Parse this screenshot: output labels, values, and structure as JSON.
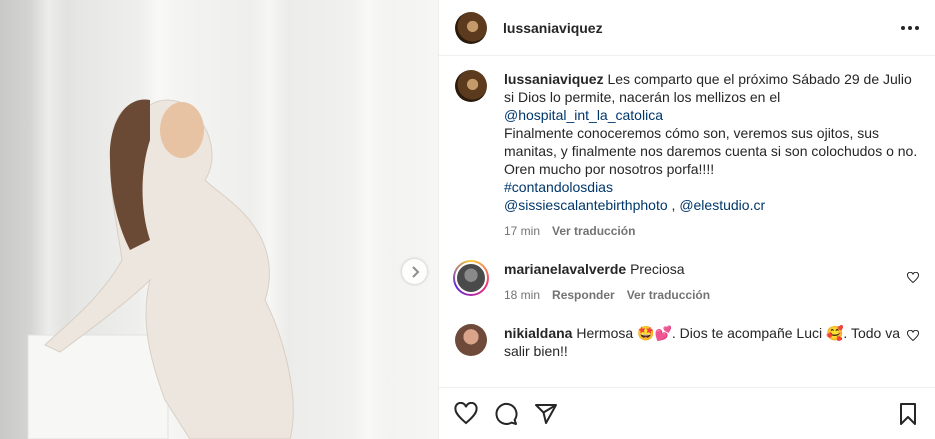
{
  "post": {
    "username": "lussaniaviquez",
    "caption_lines": [
      "Les comparto que el próximo Sábado 29 de Julio si Dios lo permite, nacerán los mellizos en el",
      "@hospital_int_la_catolica",
      "Finalmente conoceremos cómo son, veremos sus ojitos, sus manitas, y finalmente nos daremos cuenta si son colochudos o no.",
      "Oren mucho por nosotros porfa!!!!",
      "#contandolosdias",
      "@sissiescalantebirthphoto",
      "@elestudio.cr"
    ],
    "mention_separator": " , ",
    "time": "17 min",
    "translate": "Ver traducción"
  },
  "comments": [
    {
      "username": "marianelavalverde",
      "text": "Preciosa",
      "time": "18 min",
      "reply": "Responder",
      "translate": "Ver traducción"
    },
    {
      "username": "nikialdana",
      "text": "Hermosa 🤩💕. Dios te acompañe Luci 🥰. Todo va salir bien!!"
    }
  ],
  "icons": [
    "more-icon",
    "chevron-right-icon",
    "heart-icon",
    "comment-icon",
    "share-icon",
    "bookmark-icon"
  ]
}
